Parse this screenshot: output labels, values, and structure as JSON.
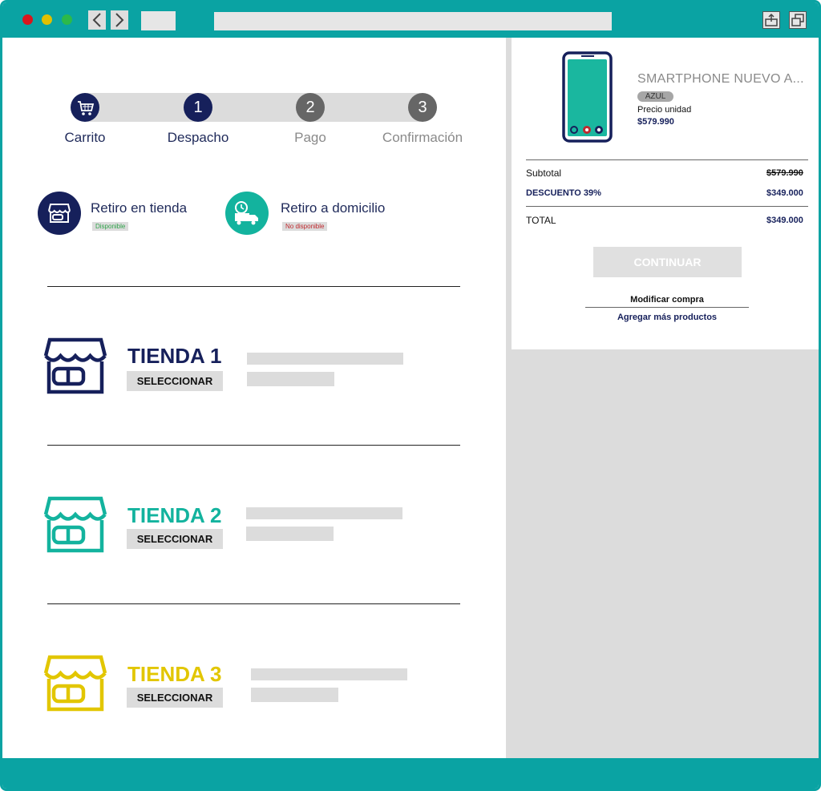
{
  "colors": {
    "teal": "#0aa3a3",
    "navy": "#16205b",
    "green": "#13b39e",
    "yellow": "#e2c600",
    "step_inactive": "#666666"
  },
  "browser": {
    "window_controls": [
      "close",
      "minimize",
      "maximize"
    ],
    "back_icon": "chevron-left",
    "forward_icon": "chevron-right",
    "share_icon": "share",
    "restore_icon": "window-restore"
  },
  "steps": [
    {
      "label": "Carrito",
      "marker": "cart-icon"
    },
    {
      "label": "Despacho",
      "number": "1"
    },
    {
      "label": "Pago",
      "number": "2"
    },
    {
      "label": "Confirmación",
      "number": "3"
    }
  ],
  "delivery": {
    "pickup": {
      "title": "Retiro en tienda",
      "status": "Disponible",
      "status_color": "#2fa34a"
    },
    "home": {
      "title": "Retiro a domicilio",
      "status": "No disponible",
      "status_color": "#c0292e"
    }
  },
  "stores": [
    {
      "name": "TIENDA 1",
      "button": "SELECCIONAR",
      "color": "#16205b"
    },
    {
      "name": "TIENDA 2",
      "button": "SELECCIONAR",
      "color": "#13b39e"
    },
    {
      "name": "TIENDA 3",
      "button": "SELECCIONAR",
      "color": "#e2c600"
    }
  ],
  "product": {
    "name": "SMARTPHONE NUEVO A...",
    "color": "AZUL",
    "unit_price_label": "Precio unidad",
    "unit_price": "$579.990"
  },
  "summary": {
    "subtotal_label": "Subtotal",
    "subtotal_value": "$579.990",
    "discount_label": "DESCUENTO 39%",
    "discount_value": "$349.000",
    "total_label": "TOTAL",
    "total_value": "$349.000"
  },
  "actions": {
    "continue": "CONTINUAR",
    "modify": "Modificar compra",
    "add_more": "Agregar más productos"
  }
}
